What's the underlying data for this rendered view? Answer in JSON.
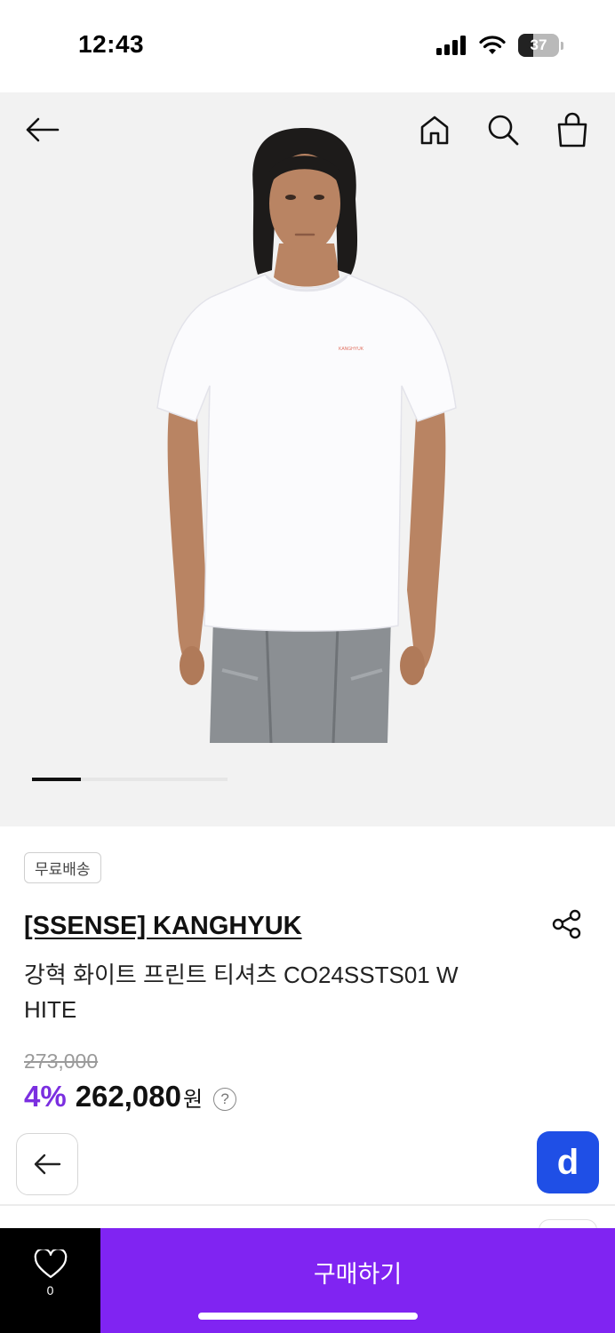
{
  "status_bar": {
    "time": "12:43",
    "battery": "37",
    "battery_level": 0.37
  },
  "nav": {
    "back_icon": "arrow-left-icon",
    "home_icon": "home-icon",
    "search_icon": "search-icon",
    "cart_icon": "shopping-bag-icon"
  },
  "carousel": {
    "progress": 0.25
  },
  "product": {
    "badge": "무료배송",
    "brand": "[SSENSE] KANGHYUK",
    "title": "강혁 화이트 프린트 티셔츠 CO24SSTS01 W HITE",
    "original_price": "273,000",
    "discount": "4%",
    "price": "262,080",
    "currency": "원",
    "help": "?",
    "shirt_print": "KANGHYUK"
  },
  "floating": {
    "d_label": "d"
  },
  "bottom_bar": {
    "wish_count": "0",
    "buy_label": "구매하기"
  },
  "colors": {
    "accent": "#8024f2",
    "discount": "#7b2fe0",
    "d_button": "#1f4fe6"
  }
}
